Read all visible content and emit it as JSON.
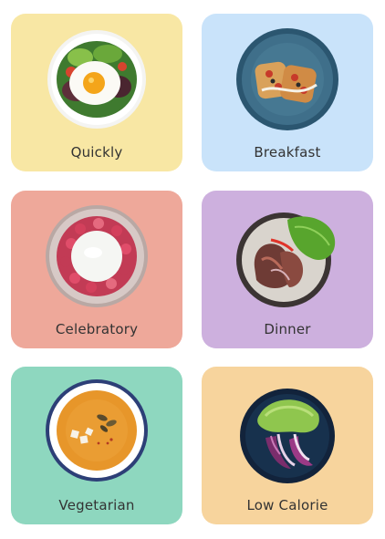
{
  "categories": [
    {
      "label": "Quickly",
      "color": "#F8E7A4",
      "icon": "fried-egg-salad-icon"
    },
    {
      "label": "Breakfast",
      "color": "#C9E3FA",
      "icon": "toast-plate-icon"
    },
    {
      "label": "Celebratory",
      "color": "#EEA89A",
      "icon": "berry-tart-icon"
    },
    {
      "label": "Dinner",
      "color": "#CDB0DE",
      "icon": "steak-plate-icon"
    },
    {
      "label": "Vegetarian",
      "color": "#8ED7BF",
      "icon": "pumpkin-soup-icon"
    },
    {
      "label": "Low Calorie",
      "color": "#F7D49D",
      "icon": "lettuce-bowl-icon"
    }
  ]
}
